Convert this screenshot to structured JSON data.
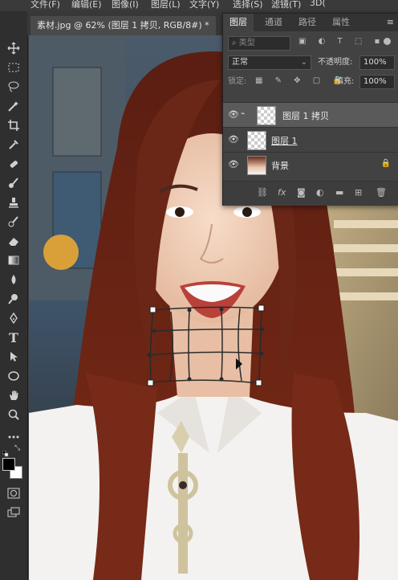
{
  "menubar": {
    "items": [
      "文件(F)",
      "编辑(E)",
      "图像(I)",
      "图层(L)",
      "文字(Y)",
      "选择(S)",
      "滤镜(T)",
      "3D("
    ]
  },
  "toolbar": {
    "tools": [
      "move-icon",
      "marquee-icon",
      "lasso-icon",
      "magic-wand-icon",
      "crop-icon",
      "eyedropper-icon",
      "healing-icon",
      "brush-icon",
      "stamp-icon",
      "history-brush-icon",
      "eraser-icon",
      "gradient-icon",
      "blur-icon",
      "dodge-icon",
      "pen-icon",
      "type-icon",
      "path-select-icon",
      "shape-icon",
      "hand-icon",
      "zoom-icon",
      "more-icon"
    ],
    "type_glyph": "T",
    "foreground_color": "#000000",
    "background_color": "#ffffff"
  },
  "document": {
    "tab_title": "素材.jpg @ 62% (图层 1 拷贝, RGB/8#) *"
  },
  "layers_panel": {
    "tabs": [
      "图层",
      "通道",
      "路径",
      "属性"
    ],
    "search_placeholder": "类型",
    "blend_mode": "正常",
    "opacity_label": "不透明度:",
    "opacity_value": "100%",
    "lock_label": "锁定:",
    "fill_label": "填充:",
    "fill_value": "100%",
    "layers": [
      {
        "name": "图层 1 拷贝",
        "selected": true
      },
      {
        "name": "图层 1",
        "selected": false
      },
      {
        "name": "背景",
        "selected": false
      }
    ]
  },
  "colors": {
    "panel_bg": "#424242",
    "toolbar_bg": "#2f2f2f",
    "selected_layer": "#5a5a5a",
    "hair": "#6b2414",
    "skin": "#f0c8b0"
  }
}
